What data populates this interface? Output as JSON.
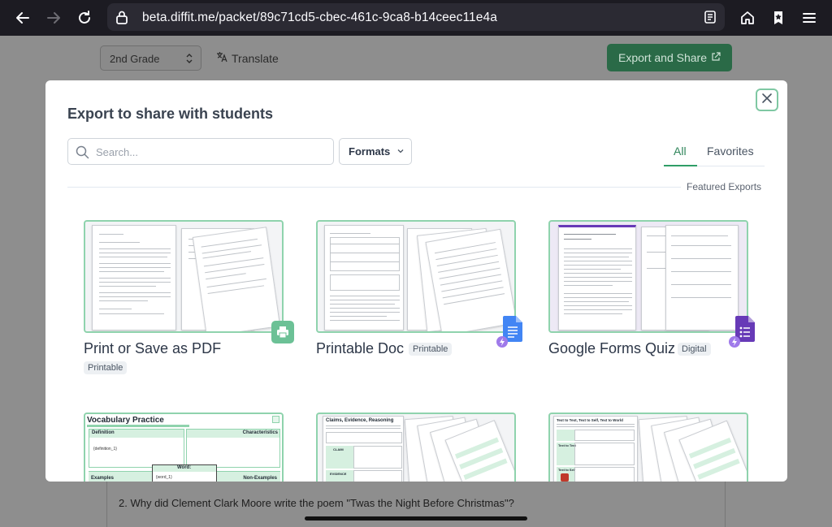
{
  "browser": {
    "url": "beta.diffit.me/packet/89c71cd5-cbec-461c-9ca8-b14ceec11e4a",
    "icons": [
      "back-arrow-icon",
      "forward-arrow-icon",
      "reload-icon",
      "lock-icon",
      "reader-mode-icon",
      "home-icon",
      "bookmarks-star-icon",
      "menu-icon"
    ]
  },
  "background_page": {
    "grade": "2nd Grade",
    "translate_label": "Translate",
    "export_share_label": "Export and Share",
    "question": "2. Why did Clement Clark Moore write the poem \"Twas the Night Before Christmas\"?"
  },
  "modal": {
    "title": "Export to share with students",
    "search_placeholder": "Search...",
    "formats_label": "Formats",
    "tabs": [
      {
        "label": "All",
        "active": true
      },
      {
        "label": "Favorites",
        "active": false
      }
    ],
    "section_label": "Featured Exports",
    "exports": [
      {
        "title": "Print or Save as PDF",
        "badge": "Printable",
        "icon": "printer-icon"
      },
      {
        "title": "Printable Doc",
        "badge": "Printable",
        "icon": "google-docs-icon"
      },
      {
        "title": "Google Forms Quiz",
        "badge": "Digital",
        "icon": "google-forms-icon"
      },
      {
        "title": "Vocabulary Practice",
        "thumb_text": {
          "title": "Vocabulary Practice",
          "definition": "Definition",
          "characteristics": "Characteristics",
          "definition_value": "{definition_1}",
          "word": "Word:",
          "word_value": "{word_1}",
          "examples": "Examples",
          "non_examples": "Non-Examples"
        }
      },
      {
        "title": "Claims, Evidence, Reasoning",
        "thumb_text": {
          "title": "Claims, Evidence, Reasoning",
          "claim": "CLAIM",
          "evidence": "EVIDENCE"
        }
      },
      {
        "title": "Text to Text, Text to Self, Text to World",
        "thumb_text": {
          "title": "Text to Text, Text to Self, Text to World",
          "row1": "Text to Text",
          "row2": "Text to Self"
        }
      }
    ]
  },
  "colors": {
    "accent_green": "#2f855a",
    "thumb_border": "#8fd3ad",
    "export_button_bg": "#2a6a47",
    "docs_blue": "#4285f4",
    "forms_purple": "#673ab7",
    "print_green": "#6cc196"
  }
}
